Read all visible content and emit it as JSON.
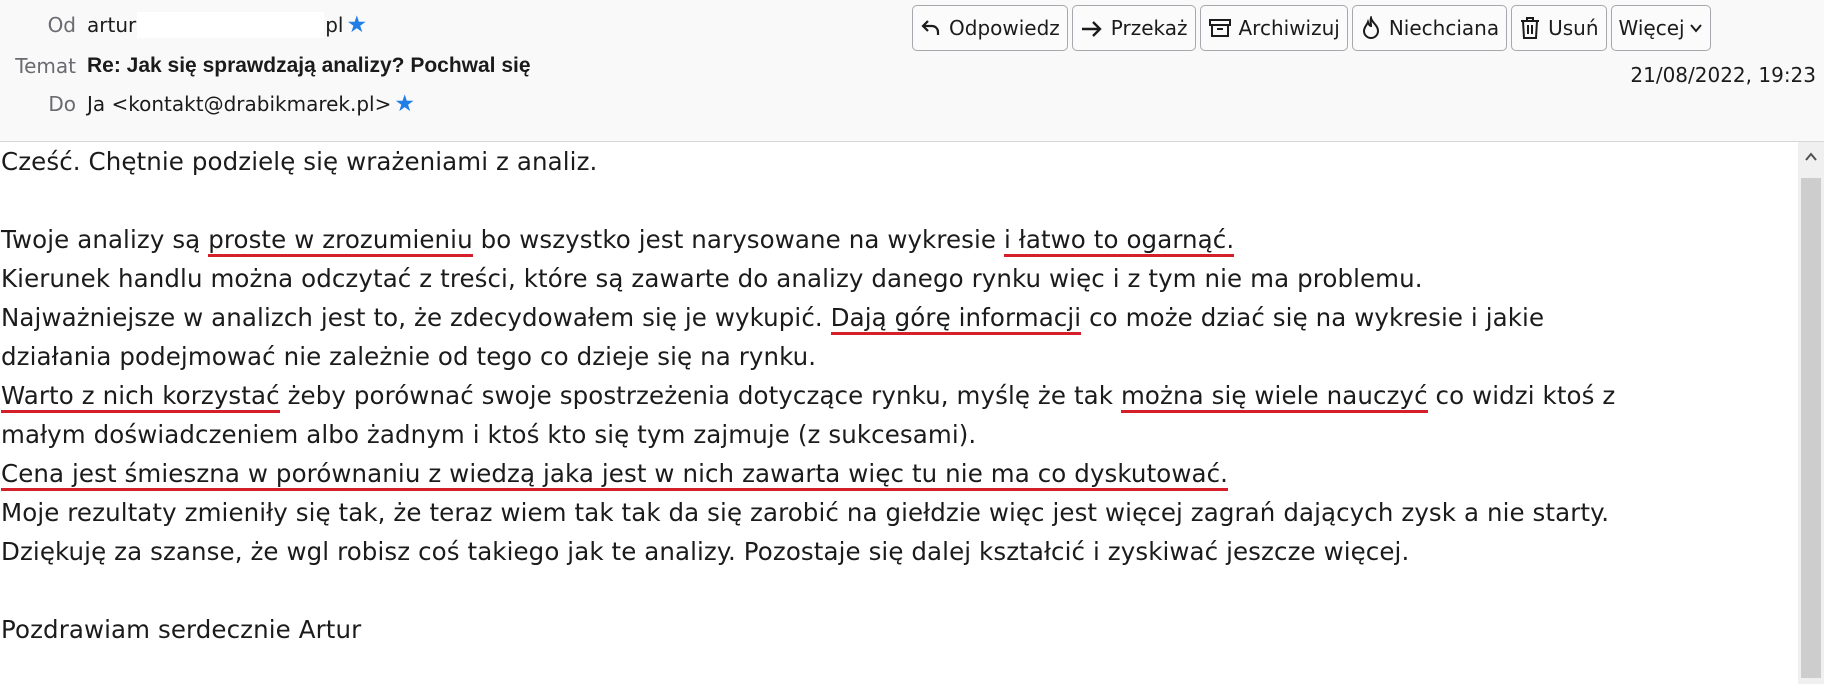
{
  "header": {
    "from_label": "Od",
    "from_name_start": "artur",
    "from_name_end": "pl",
    "subject_label": "Temat",
    "subject": "Re: Jak się sprawdzają analizy? Pochwal się",
    "to_label": "Do",
    "to_value": "Ja <kontakt@drabikmarek.pl>",
    "date": "21/08/2022, 19:23"
  },
  "toolbar": {
    "reply": "Odpowiedz",
    "forward": "Przekaż",
    "archive": "Archiwizuj",
    "junk": "Niechciana",
    "delete": "Usuń",
    "more": "Więcej"
  },
  "message": {
    "l1": "Cześć. Chętnie podzielę się wrażeniami z analiz.",
    "l2a": "Twoje analizy są ",
    "l2b": "proste w zrozumieniu",
    "l2c": " bo wszystko jest narysowane na wykresie ",
    "l2d": "i łatwo to ogarnąć.",
    "l3": "Kierunek handlu można odczytać z treści, które są zawarte do analizy danego rynku więc i z tym nie ma problemu.",
    "l4a": "Najważniejsze w analizch jest to, że zdecydowałem się je wykupić. ",
    "l4b": "Dają górę informacji",
    "l4c": " co może dziać się na wykresie i jakie",
    "l5": "działania podejmować nie zależnie od tego co dzieje się na rynku.",
    "l6a": "Warto z nich korzystać",
    "l6b": " żeby porównać swoje spostrzeżenia dotyczące rynku, myślę że tak ",
    "l6c": "można się wiele nauczyć",
    "l6d": " co widzi ktoś z",
    "l7": "małym doświadczeniem albo żadnym i ktoś kto się tym zajmuje (z sukcesami).",
    "l8": "Cena jest śmieszna w porównaniu z wiedzą jaka jest w nich zawarta więc tu nie ma co dyskutować.",
    "l9": "Moje rezultaty zmieniły się tak, że teraz wiem tak tak da się zarobić na giełdzie więc jest więcej zagrań dających zysk a nie starty.",
    "l10": "Dziękuję za szanse, że wgl robisz coś takiego jak te analizy. Pozostaje się dalej kształcić i zyskiwać jeszcze więcej.",
    "l12": "Pozdrawiam serdecznie Artur"
  },
  "colors": {
    "underline": "#d5202b",
    "star": "#1f7fe6",
    "header_bg": "#f9f9fa"
  },
  "icons": [
    "reply-icon",
    "forward-icon",
    "archive-icon",
    "junk-icon",
    "trash-icon",
    "chevron-down-icon",
    "star-icon"
  ]
}
